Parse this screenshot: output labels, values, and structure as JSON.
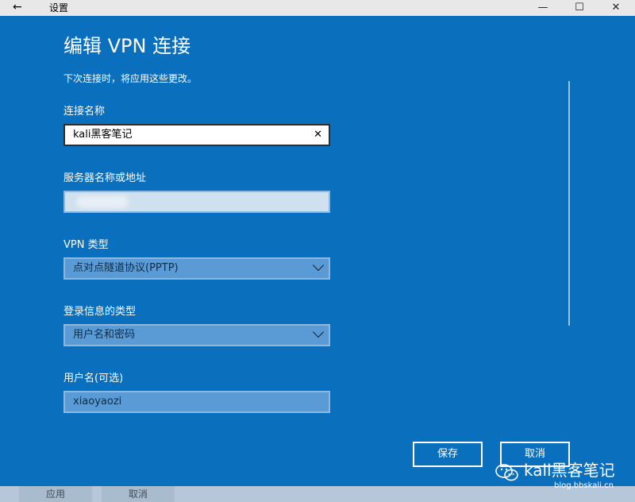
{
  "window": {
    "title": "设置",
    "back_icon": "←",
    "minimize_icon": "—",
    "maximize_icon": "☐",
    "close_icon": "✕"
  },
  "dialog": {
    "heading": "编辑 VPN 连接",
    "subtext": "下次连接时，将应用这些更改。",
    "connection_name": {
      "label": "连接名称",
      "value": "kali黑客笔记",
      "clear_icon": "✕"
    },
    "server": {
      "label": "服务器名称或地址",
      "value": ""
    },
    "vpn_type": {
      "label": "VPN 类型",
      "value": "点对点隧道协议(PPTP)"
    },
    "sign_in_type": {
      "label": "登录信息的类型",
      "value": "用户名和密码"
    },
    "username": {
      "label": "用户名(可选)",
      "value": "xiaoyaozi"
    },
    "save_label": "保存",
    "cancel_label": "取消"
  },
  "bottom": {
    "apply_label": "应用",
    "cancel_label": "取消"
  },
  "watermark": {
    "name": "kali黑客笔记",
    "url": "blog.bbskali.cn",
    "icon": "wechat-icon"
  }
}
